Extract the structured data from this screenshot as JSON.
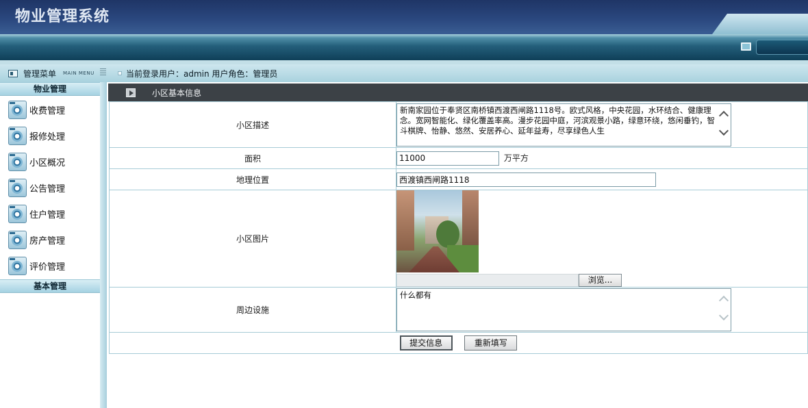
{
  "app": {
    "title": "物业管理系统"
  },
  "menu": {
    "label": "管理菜单",
    "sub_label": "MAIN MENU"
  },
  "user_bar": {
    "text": "当前登录用户：admin 用户角色：管理员"
  },
  "sidebar": {
    "group_property": "物业管理",
    "items": [
      {
        "label": "收费管理",
        "icon": "gear-icon"
      },
      {
        "label": "报修处理",
        "icon": "gear-icon"
      },
      {
        "label": "小区概况",
        "icon": "gear-icon"
      },
      {
        "label": "公告管理",
        "icon": "gear-icon"
      },
      {
        "label": "住户管理",
        "icon": "gear-icon"
      },
      {
        "label": "房产管理",
        "icon": "gear-icon"
      },
      {
        "label": "评价管理",
        "icon": "gear-icon"
      }
    ],
    "group_basic": "基本管理"
  },
  "section": {
    "title": "小区基本信息"
  },
  "form": {
    "description": {
      "label": "小区描述",
      "value": "新南家园位于奉贤区南桥镇西渡西闸路1118号。欧式风格，中央花园，水环结合、健康理念。宽网智能化、绿化覆盖率高。漫步花园中庭，河滨观景小路，绿意环绕，悠闲垂钓，智斗棋牌、怡静、悠然、安居养心、延年益寿，尽享绿色人生"
    },
    "area": {
      "label": "面积",
      "value": "11000",
      "unit": "万平方"
    },
    "location": {
      "label": "地理位置",
      "value": "西渡镇西闸路1118"
    },
    "picture": {
      "label": "小区图片",
      "browse_label": "浏览..."
    },
    "facilities": {
      "label": "周边设施",
      "value": "什么都有"
    },
    "buttons": {
      "submit": "提交信息",
      "reset": "重新填写"
    }
  },
  "colors": {
    "banner": "#2a477e",
    "sidebar_header": "#a9d2de",
    "section_bar": "#3c4146",
    "table_border": "#a6cbd6"
  }
}
